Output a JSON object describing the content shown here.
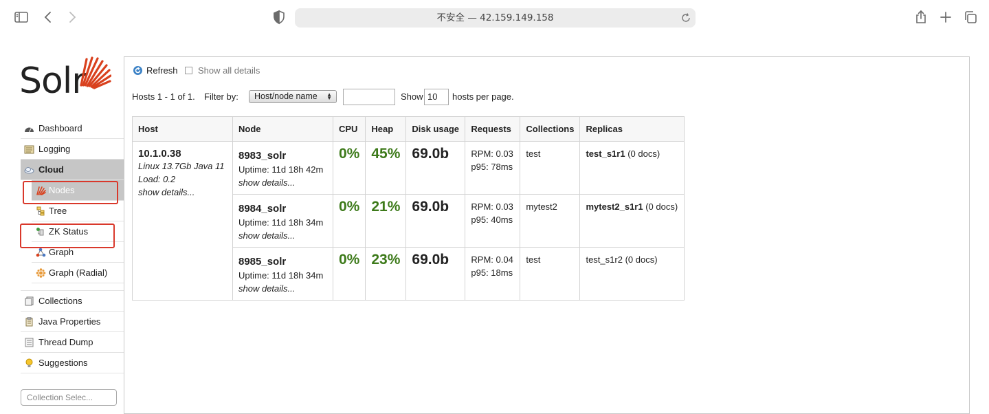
{
  "browser": {
    "address": "不安全 — 42.159.149.158"
  },
  "brand": {
    "logo_text": "Solr"
  },
  "sidebar": {
    "items": [
      {
        "label": "Dashboard"
      },
      {
        "label": "Logging"
      },
      {
        "label": "Cloud"
      }
    ],
    "cloud_sub": [
      {
        "label": "Nodes"
      },
      {
        "label": "Tree"
      },
      {
        "label": "ZK Status"
      },
      {
        "label": "Graph"
      },
      {
        "label": "Graph (Radial)"
      }
    ],
    "items_after": [
      {
        "label": "Collections"
      },
      {
        "label": "Java Properties"
      },
      {
        "label": "Thread Dump"
      },
      {
        "label": "Suggestions"
      }
    ],
    "collection_selector": "Collection Selec..."
  },
  "main": {
    "refresh_label": "Refresh",
    "show_all_label": "Show all details",
    "hosts_summary": "Hosts 1 - 1 of 1.",
    "filter_by_label": "Filter by:",
    "filter_select_value": "Host/node name",
    "filter_text_value": "",
    "show_label": "Show",
    "per_page_value": "10",
    "per_page_suffix": "hosts per page."
  },
  "table": {
    "headers": [
      "Host",
      "Node",
      "CPU",
      "Heap",
      "Disk usage",
      "Requests",
      "Collections",
      "Replicas"
    ],
    "host": {
      "name": "10.1.0.38",
      "os": "Linux 13.7Gb Java 11",
      "load": "Load: 0.2",
      "details": "show details..."
    },
    "nodes": [
      {
        "name": "8983_solr",
        "uptime": "Uptime: 11d 18h 42m",
        "details": "show details...",
        "cpu": "0%",
        "heap": "45%",
        "disk": "69.0b",
        "rpm": "RPM: 0.03",
        "p95": "p95: 78ms",
        "collection": "test",
        "replica_name": "test_s1r1",
        "replica_docs": "(0 docs)",
        "replica_bold": true
      },
      {
        "name": "8984_solr",
        "uptime": "Uptime: 11d 18h 34m",
        "details": "show details...",
        "cpu": "0%",
        "heap": "21%",
        "disk": "69.0b",
        "rpm": "RPM: 0.03",
        "p95": "p95: 40ms",
        "collection": "mytest2",
        "replica_name": "mytest2_s1r1",
        "replica_docs": "(0 docs)",
        "replica_bold": true
      },
      {
        "name": "8985_solr",
        "uptime": "Uptime: 11d 18h 34m",
        "details": "show details...",
        "cpu": "0%",
        "heap": "23%",
        "disk": "69.0b",
        "rpm": "RPM: 0.04",
        "p95": "p95: 18ms",
        "collection": "test",
        "replica_name": "test_s1r2",
        "replica_docs": "(0 docs)",
        "replica_bold": false
      }
    ]
  },
  "colors": {
    "accent_green": "#3d7a1a",
    "highlight_red": "#d9382b",
    "solr_orange": "#d9411e"
  },
  "icons": {
    "toolbar": [
      "sidebar-icon",
      "back-icon",
      "forward-icon",
      "shield-icon",
      "reload-icon",
      "share-icon",
      "new-tab-icon",
      "tabs-icon"
    ]
  }
}
